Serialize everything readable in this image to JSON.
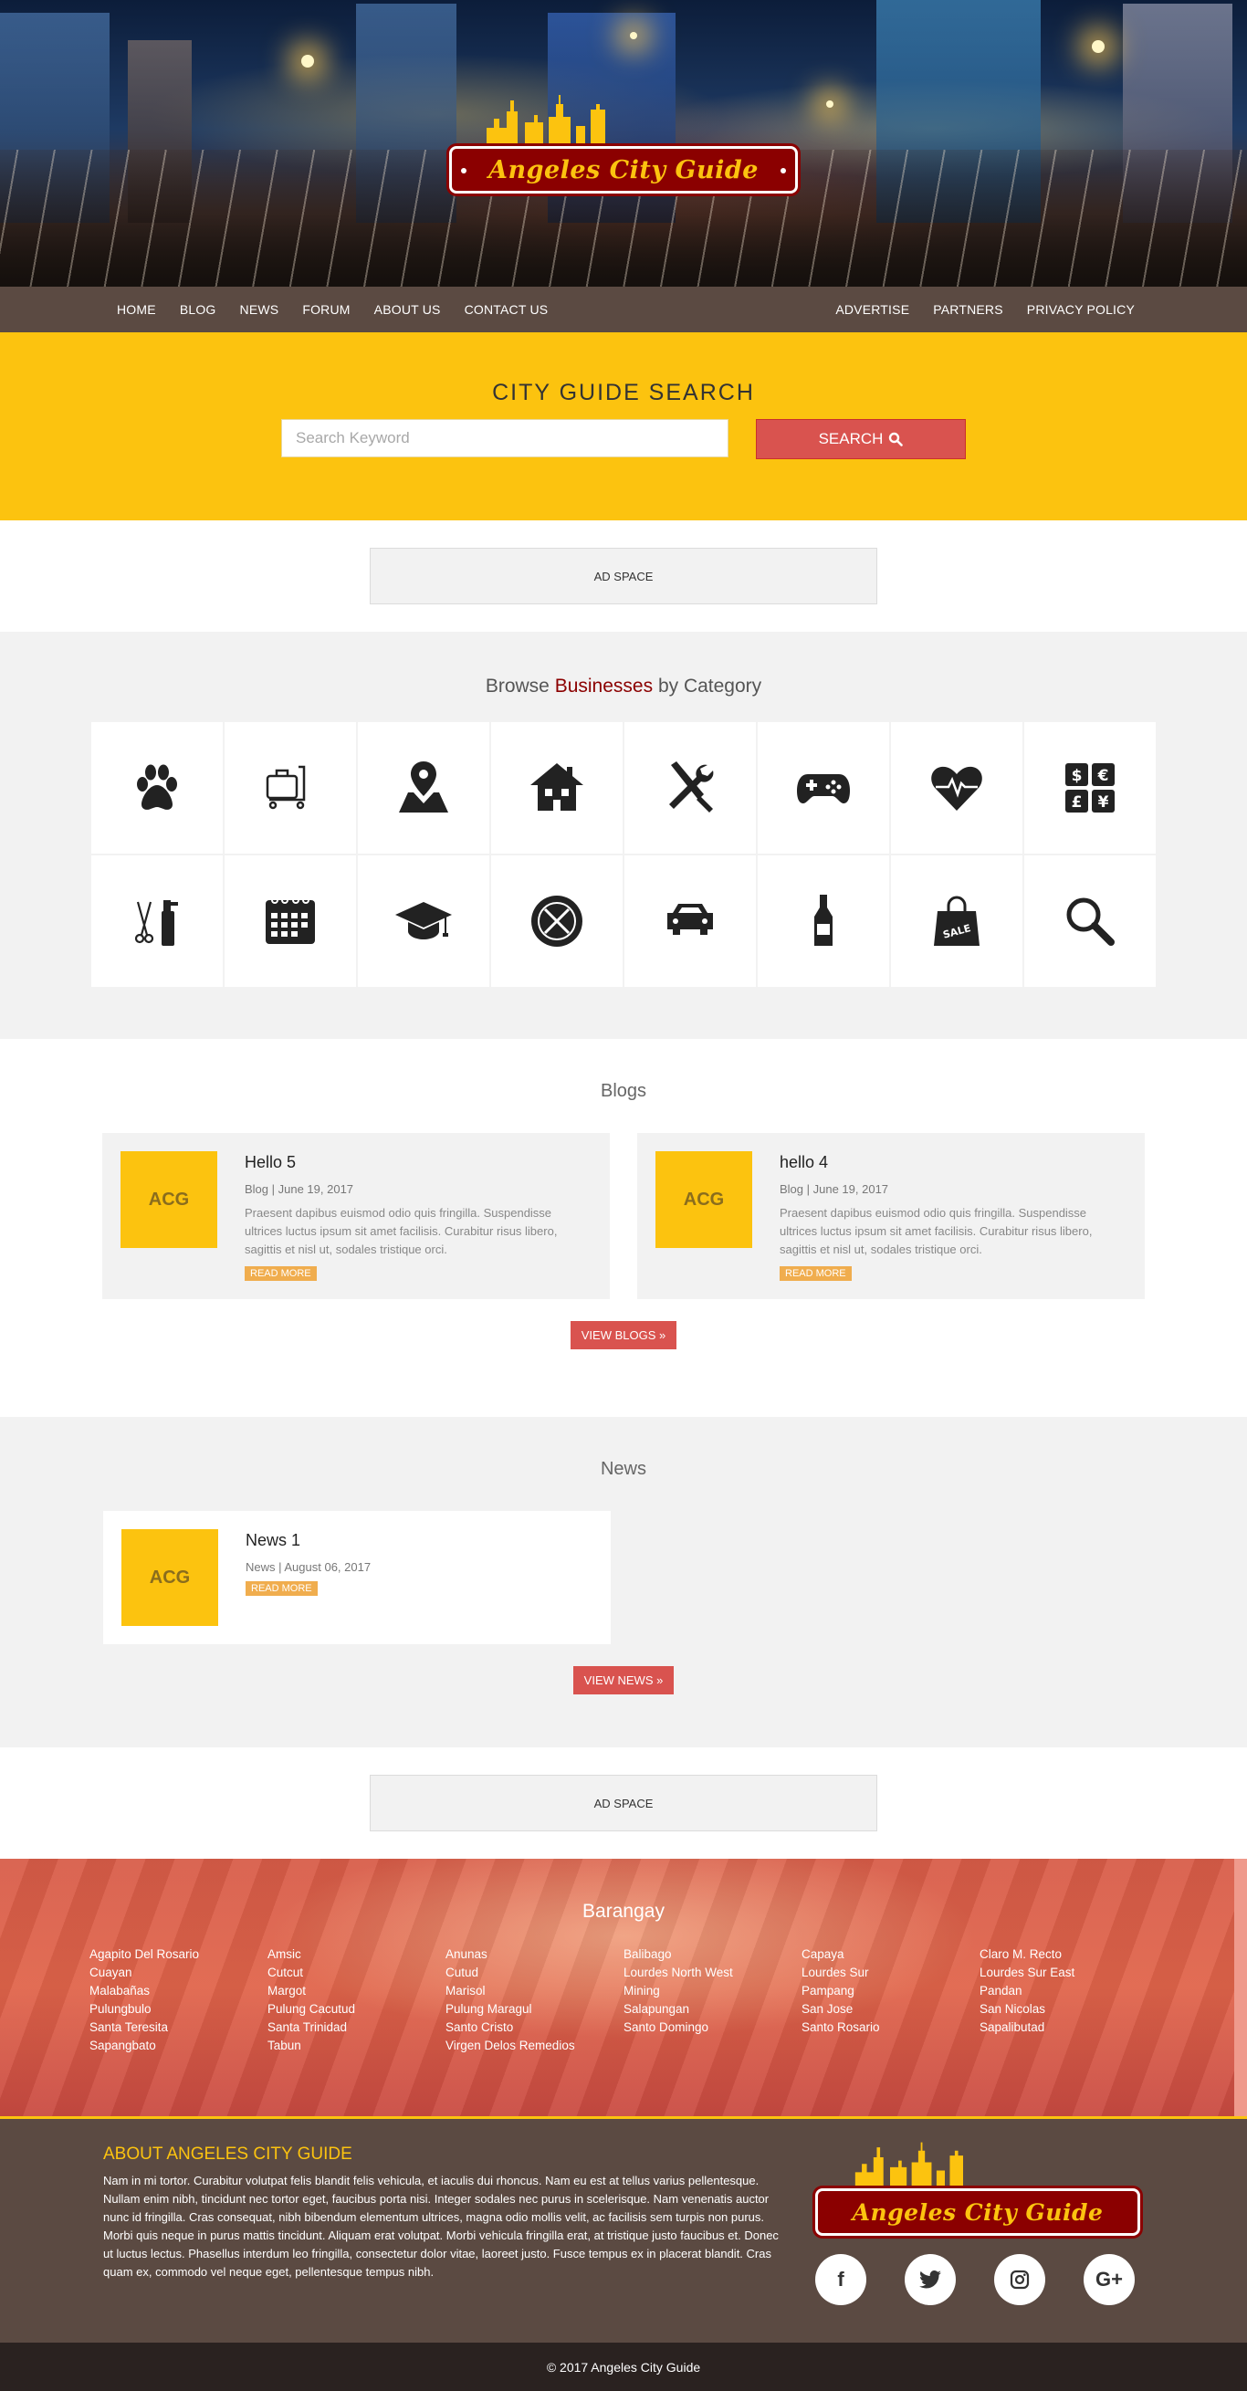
{
  "logo": {
    "text": "Angeles City Guide"
  },
  "nav": {
    "left": [
      "HOME",
      "BLOG",
      "NEWS",
      "FORUM",
      "ABOUT US",
      "CONTACT US"
    ],
    "right": [
      "ADVERTISE",
      "PARTNERS",
      "PRIVACY POLICY"
    ]
  },
  "search": {
    "title": "CITY GUIDE SEARCH",
    "placeholder": "Search Keyword",
    "button": "SEARCH"
  },
  "ads": {
    "label": "AD SPACE"
  },
  "browse": {
    "prefix": "Browse",
    "highlight": "Businesses",
    "suffix": "by Category",
    "categories": [
      "paw-icon",
      "luggage-cart-icon",
      "map-pin-icon",
      "house-icon",
      "tools-icon",
      "gamepad-icon",
      "heartbeat-icon",
      "currency-icon",
      "salon-icon",
      "calendar-icon",
      "graduation-cap-icon",
      "dining-icon",
      "car-icon",
      "bottle-icon",
      "sale-bag-icon",
      "magnifier-icon"
    ]
  },
  "blogs": {
    "title": "Blogs",
    "items": [
      {
        "thumb": "ACG",
        "title": "Hello 5",
        "meta": "Blog | June 19, 2017",
        "excerpt": "Praesent dapibus euismod odio quis fringilla. Suspendisse ultrices luctus ipsum sit amet facilisis. Curabitur risus libero, sagittis et nisl ut, sodales tristique orci.",
        "more": "READ MORE"
      },
      {
        "thumb": "ACG",
        "title": "hello 4",
        "meta": "Blog | June 19, 2017",
        "excerpt": "Praesent dapibus euismod odio quis fringilla. Suspendisse ultrices luctus ipsum sit amet facilisis. Curabitur risus libero, sagittis et nisl ut, sodales tristique orci.",
        "more": "READ MORE"
      }
    ],
    "view": "VIEW BLOGS »"
  },
  "news": {
    "title": "News",
    "items": [
      {
        "thumb": "ACG",
        "title": "News 1",
        "meta": "News | August 06, 2017",
        "more": "READ MORE"
      }
    ],
    "view": "VIEW NEWS »"
  },
  "barangay": {
    "title": "Barangay",
    "columns": [
      [
        "Agapito Del Rosario",
        "Cuayan",
        "Malabañas",
        "Pulungbulo",
        "Santa Teresita",
        "Sapangbato"
      ],
      [
        "Amsic",
        "Cutcut",
        "Margot",
        "Pulung Cacutud",
        "Santa Trinidad",
        "Tabun"
      ],
      [
        "Anunas",
        "Cutud",
        "Marisol",
        "Pulung Maragul",
        "Santo Cristo",
        "Virgen Delos Remedios"
      ],
      [
        "Balibago",
        "Lourdes North West",
        "Mining",
        "Salapungan",
        "Santo Domingo"
      ],
      [
        "Capaya",
        "Lourdes Sur",
        "Pampang",
        "San Jose",
        "Santo Rosario"
      ],
      [
        "Claro M. Recto",
        "Lourdes Sur East",
        "Pandan",
        "San Nicolas",
        "Sapalibutad"
      ]
    ]
  },
  "about": {
    "title": "ABOUT ANGELES CITY GUIDE",
    "text": "Nam in mi tortor. Curabitur volutpat felis blandit felis vehicula, et iaculis dui rhoncus. Nam eu est at tellus varius pellentesque. Nullam enim nibh, tincidunt nec tortor eget, faucibus porta nisi. Integer sodales nec purus in scelerisque. Nam venenatis auctor nunc id fringilla. Cras consequat, nibh bibendum elementum ultrices, magna odio mollis velit, ac facilisis sem turpis non purus. Morbi quis neque in purus mattis tincidunt. Aliquam erat volutpat. Morbi vehicula fringilla erat, at tristique justo faucibus et. Donec ut luctus lectus. Phasellus interdum leo fringilla, consectetur dolor vitae, laoreet justo. Fusce tempus ex in placerat blandit. Cras quam ex, commodo vel neque eget, pellentesque tempus nibh.",
    "social": [
      {
        "icon": "facebook-icon",
        "glyph": "f"
      },
      {
        "icon": "twitter-icon",
        "glyph": "t"
      },
      {
        "icon": "instagram-icon",
        "glyph": "◎"
      },
      {
        "icon": "google-plus-icon",
        "glyph": "G+"
      }
    ]
  },
  "footer": {
    "copyright": "© 2017 Angeles City Guide"
  },
  "colors": {
    "accent": "#fcc30f",
    "brown": "#5b4a42",
    "red": "#d9534f",
    "brand_dark_red": "#8b0000"
  }
}
